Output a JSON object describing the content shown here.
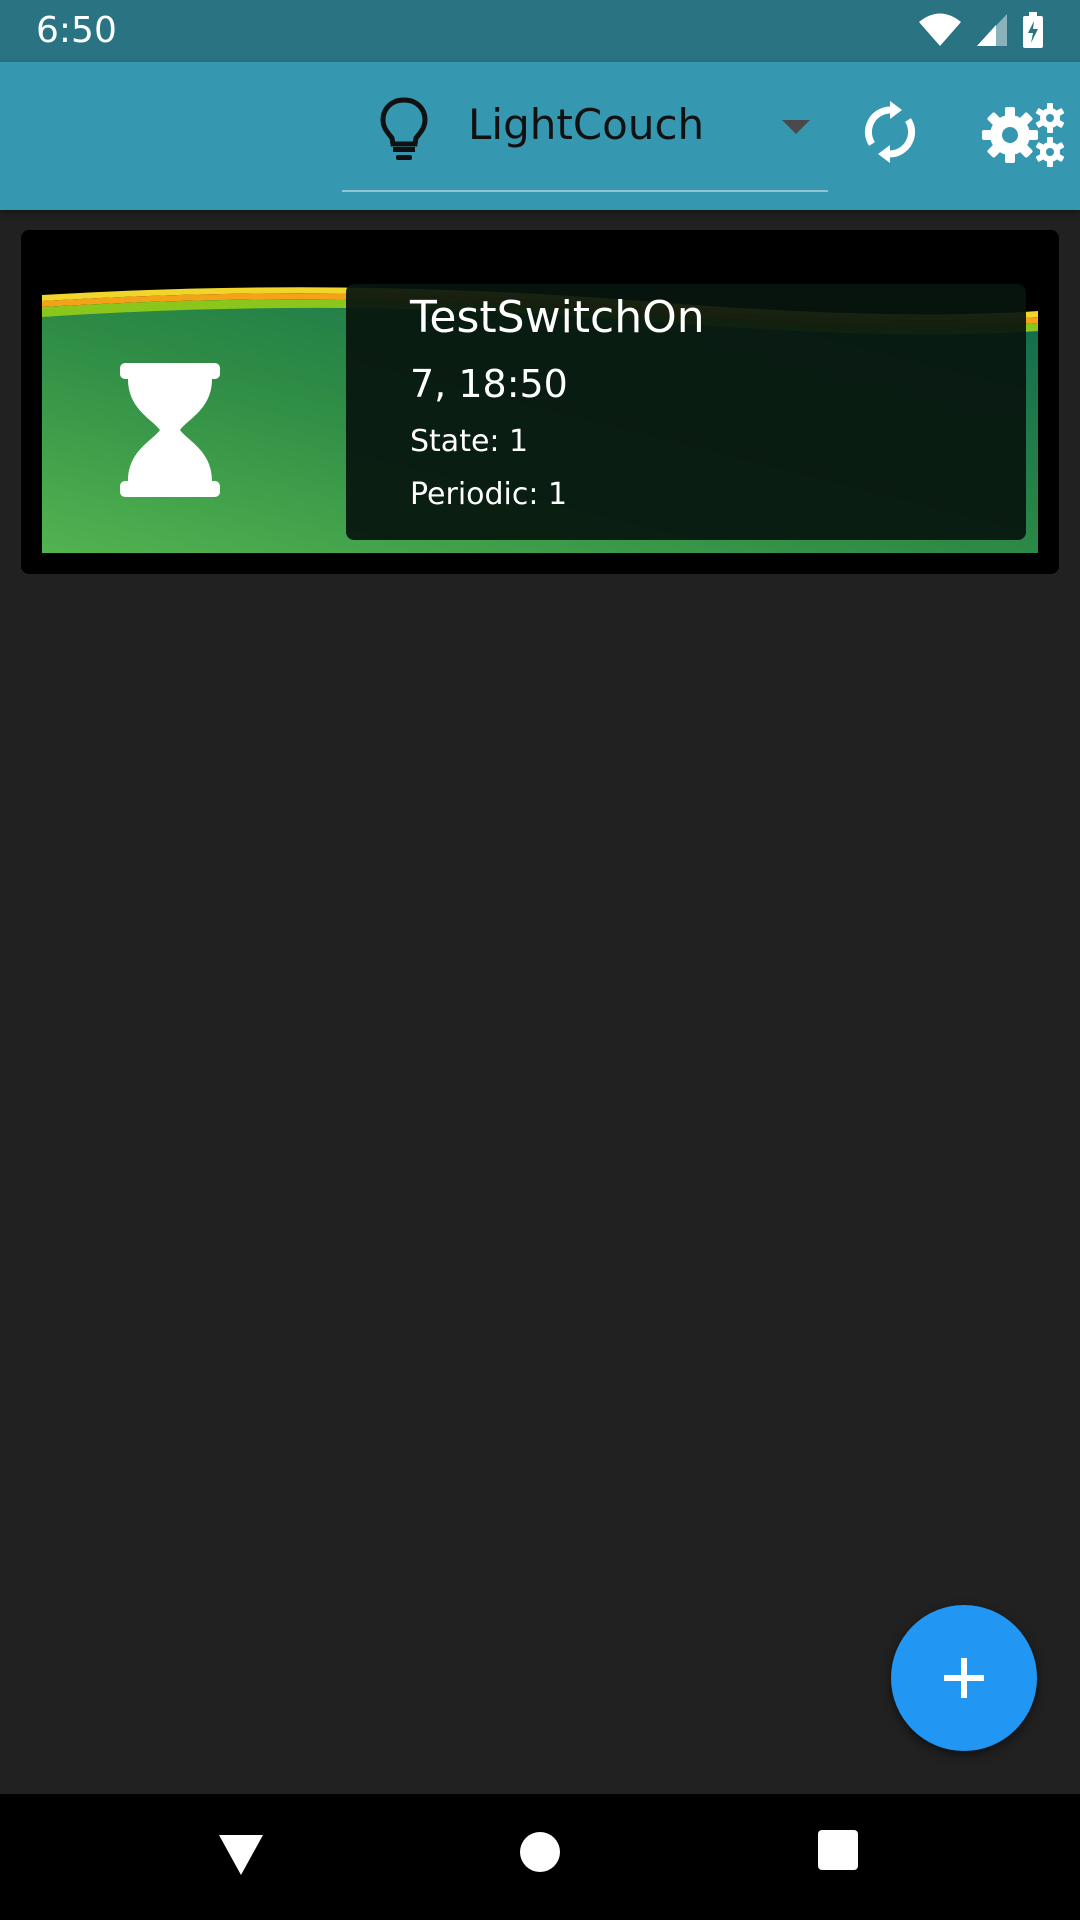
{
  "status_bar": {
    "time": "6:50",
    "icons": [
      "wifi-icon",
      "signal-icon",
      "battery-charging-icon"
    ]
  },
  "app_bar": {
    "device_select": {
      "icon": "lightbulb-icon",
      "selected_value": "LightCouch"
    },
    "actions": [
      "sync-icon",
      "settings-icon"
    ],
    "colors": {
      "background": "#3598b0",
      "status_bar": "#2a7383"
    }
  },
  "timers": [
    {
      "icon": "hourglass-icon",
      "name": "TestSwitchOn",
      "time": "7, 18:50",
      "state": "State: 1",
      "periodic": "Periodic: 1"
    }
  ],
  "fab": {
    "icon": "plus-icon",
    "color": "#2196f3"
  },
  "nav_bar": {
    "icons": [
      "back-icon",
      "home-icon",
      "recents-icon"
    ]
  }
}
